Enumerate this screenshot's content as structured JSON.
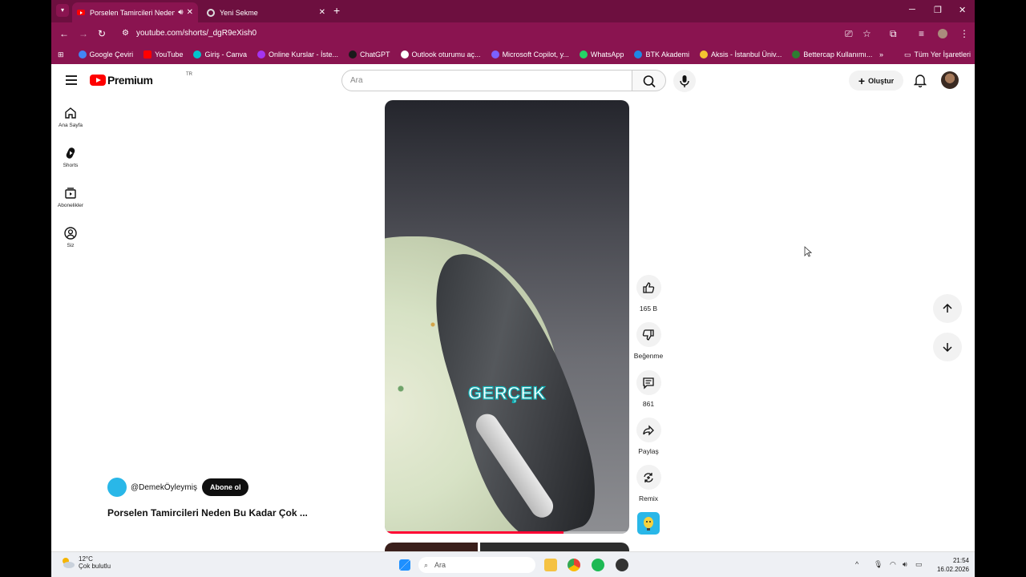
{
  "browser": {
    "tabs": [
      {
        "label": "Porselen Tamircileri Neden Bu",
        "active": true
      },
      {
        "label": "Yeni Sekme",
        "active": false
      }
    ],
    "url": "youtube.com/shorts/_dgR9eXish0",
    "bookmarks": [
      {
        "label": "Google Çeviri",
        "color": "#4285f4"
      },
      {
        "label": "YouTube",
        "color": "#ff0000"
      },
      {
        "label": "Giriş - Canva",
        "color": "#00c4cc"
      },
      {
        "label": "Online Kurslar - İste...",
        "color": "#a435f0"
      },
      {
        "label": "ChatGPT",
        "color": "#1a1a1a"
      },
      {
        "label": "Outlook oturumu aç...",
        "color": "#ffffff"
      },
      {
        "label": "Microsoft Copilot, y...",
        "color": "#7b61ff"
      },
      {
        "label": "WhatsApp",
        "color": "#25d366"
      },
      {
        "label": "BTK Akademi",
        "color": "#1e88e5"
      },
      {
        "label": "Aksis - İstanbul Üniv...",
        "color": "#f4c430"
      },
      {
        "label": "Bettercap Kullanımı...",
        "color": "#2e7d32"
      }
    ],
    "all_bookmarks": "Tüm Yer İşaretleri"
  },
  "youtube": {
    "logo_text": "Premium",
    "region": "TR",
    "search_placeholder": "Ara",
    "create_label": "Oluştur",
    "sidebar": [
      {
        "label": "Ana Sayfa",
        "icon": "home-icon"
      },
      {
        "label": "Shorts",
        "icon": "shorts-icon"
      },
      {
        "label": "Abonelikler",
        "icon": "subscriptions-icon"
      },
      {
        "label": "Siz",
        "icon": "you-icon"
      }
    ],
    "short": {
      "caption": "GERÇEK",
      "progress": 0.73,
      "channel": "@DemekÖyleymiş",
      "subscribe_label": "Abone ol",
      "title": "Porselen Tamircileri Neden Bu Kadar Çok ..."
    },
    "actions": {
      "like_count": "165 B",
      "dislike_label": "Beğenme",
      "comment_count": "861",
      "share_label": "Paylaş",
      "remix_label": "Remix"
    }
  },
  "taskbar": {
    "temperature": "12°C",
    "weather": "Çok bulutlu",
    "search_placeholder": "Ara",
    "time": "21:54",
    "date": "16.02.2026"
  }
}
